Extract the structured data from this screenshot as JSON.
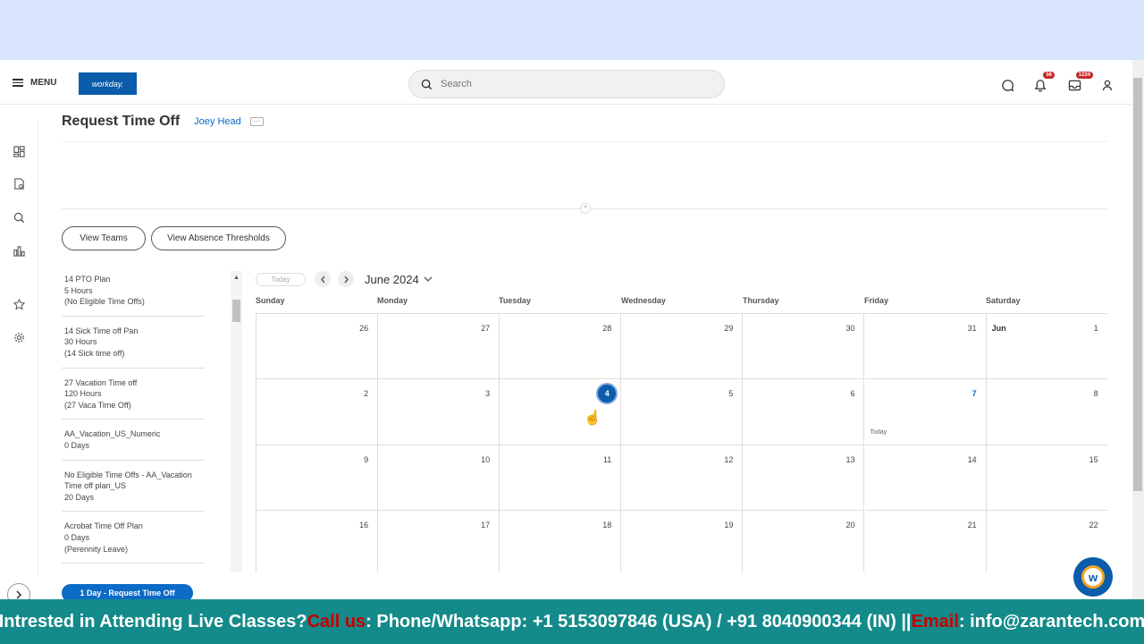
{
  "header": {
    "menu_label": "MENU",
    "logo_text": "workday.",
    "search_placeholder": "Search",
    "notifications_badge": "56",
    "inbox_badge": "1224"
  },
  "page": {
    "title": "Request Time Off",
    "worker_name": "Joey Head",
    "more_label": "···",
    "collapse_label": "^"
  },
  "buttons": {
    "view_teams": "View Teams",
    "view_absence_thresholds": "View Absence Thresholds",
    "request_time_off": "1 Day - Request Time Off"
  },
  "plans": [
    {
      "line1": "14 PTO Plan",
      "line2": "5 Hours",
      "line3": "(No Eligible Time Offs)"
    },
    {
      "line1": "14 Sick Time off Pan",
      "line2": "30 Hours",
      "line3": "(14 Sick time off)"
    },
    {
      "line1": "27 Vacation Time off",
      "line2": "120 Hours",
      "line3": "(27 Vaca Time Off)"
    },
    {
      "line1": "AA_Vacation_US_Numeric",
      "line2": "0 Days",
      "line3": ""
    },
    {
      "line1": "No Eligible Time Offs - AA_Vacation",
      "line2": "Time off plan_US",
      "line3": "20 Days"
    },
    {
      "line1": "Acrobat Time Off Plan",
      "line2": "0 Days",
      "line3": "(Perennity Leave)"
    }
  ],
  "calendar": {
    "today_button": "Today",
    "month_label": "June 2024",
    "weekdays": [
      "Sunday",
      "Monday",
      "Tuesday",
      "Wednesday",
      "Thursday",
      "Friday",
      "Saturday"
    ],
    "weeks": [
      [
        "26",
        "27",
        "28",
        "29",
        "30",
        "31",
        "1"
      ],
      [
        "2",
        "3",
        "4",
        "5",
        "6",
        "7",
        "8"
      ],
      [
        "9",
        "10",
        "11",
        "12",
        "13",
        "14",
        "15"
      ],
      [
        "16",
        "17",
        "18",
        "19",
        "20",
        "21",
        "22"
      ]
    ],
    "month_start_label": "Jun",
    "selected_date": "4",
    "today_date": "7",
    "today_marker": "Today"
  },
  "banner": {
    "part1": "Intrested in Attending Live Classes? ",
    "call_us": "Call us",
    "part2": ": Phone/Whatsapp: +1 5153097846 (USA) / +91 8040900344 (IN) || ",
    "email_label": "Email",
    "part3": ": info@zarantech.com"
  }
}
